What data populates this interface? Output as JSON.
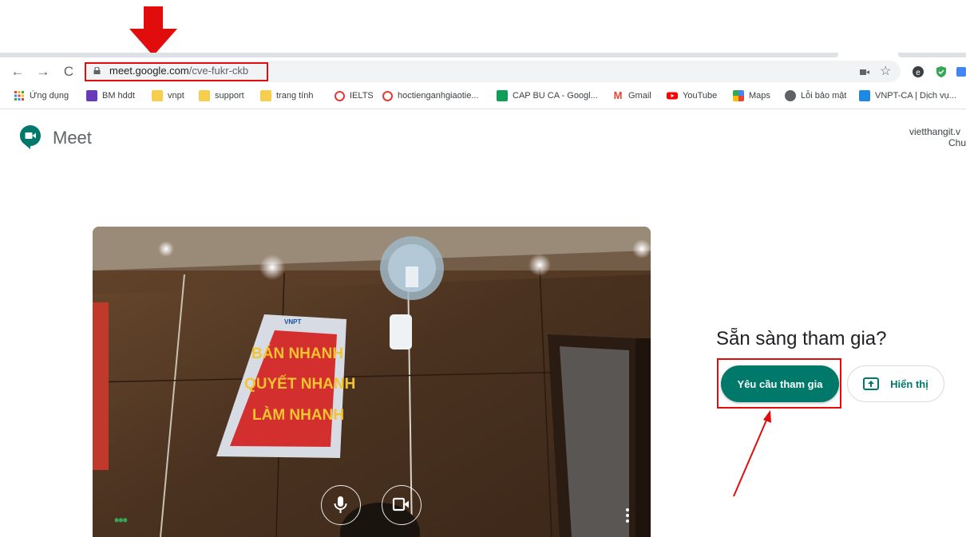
{
  "browser": {
    "url_host": "meet.google.com",
    "url_path": "/cve-fukr-ckb",
    "bookmarks": [
      {
        "label": "Ứng dụng",
        "icon": "apps-grid-icon"
      },
      {
        "label": "BM hddt",
        "icon": "form-icon"
      },
      {
        "label": "vnpt",
        "icon": "folder-icon"
      },
      {
        "label": "support",
        "icon": "folder-icon"
      },
      {
        "label": "trang tính",
        "icon": "folder-icon"
      },
      {
        "label": "IELTS",
        "icon": "e-logo-icon"
      },
      {
        "label": "hoctienganhgiaotie...",
        "icon": "e-logo-icon"
      },
      {
        "label": "CAP BU CA - Googl...",
        "icon": "sheets-icon"
      },
      {
        "label": "Gmail",
        "icon": "gmail-icon"
      },
      {
        "label": "YouTube",
        "icon": "youtube-icon"
      },
      {
        "label": "Maps",
        "icon": "maps-icon"
      },
      {
        "label": "Lỗi bảo mật",
        "icon": "globe-icon"
      },
      {
        "label": "VNPT-CA | Dịch vụ...",
        "icon": "vnpt-ca-icon"
      }
    ]
  },
  "meet": {
    "title": "Meet",
    "account_line1": "vietthangit.v",
    "account_line2": "Chu",
    "ready_text": "Sẵn sàng tham gia?",
    "join_label": "Yêu cầu tham gia",
    "present_label": "Hiển thị"
  },
  "poster": {
    "line1": "BÁN NHANH",
    "line2": "QUYẾT NHANH",
    "line3": "LÀM NHANH",
    "brand": "VNPT"
  },
  "colors": {
    "accent": "#00796b",
    "annotation_red": "#e10d0d"
  }
}
